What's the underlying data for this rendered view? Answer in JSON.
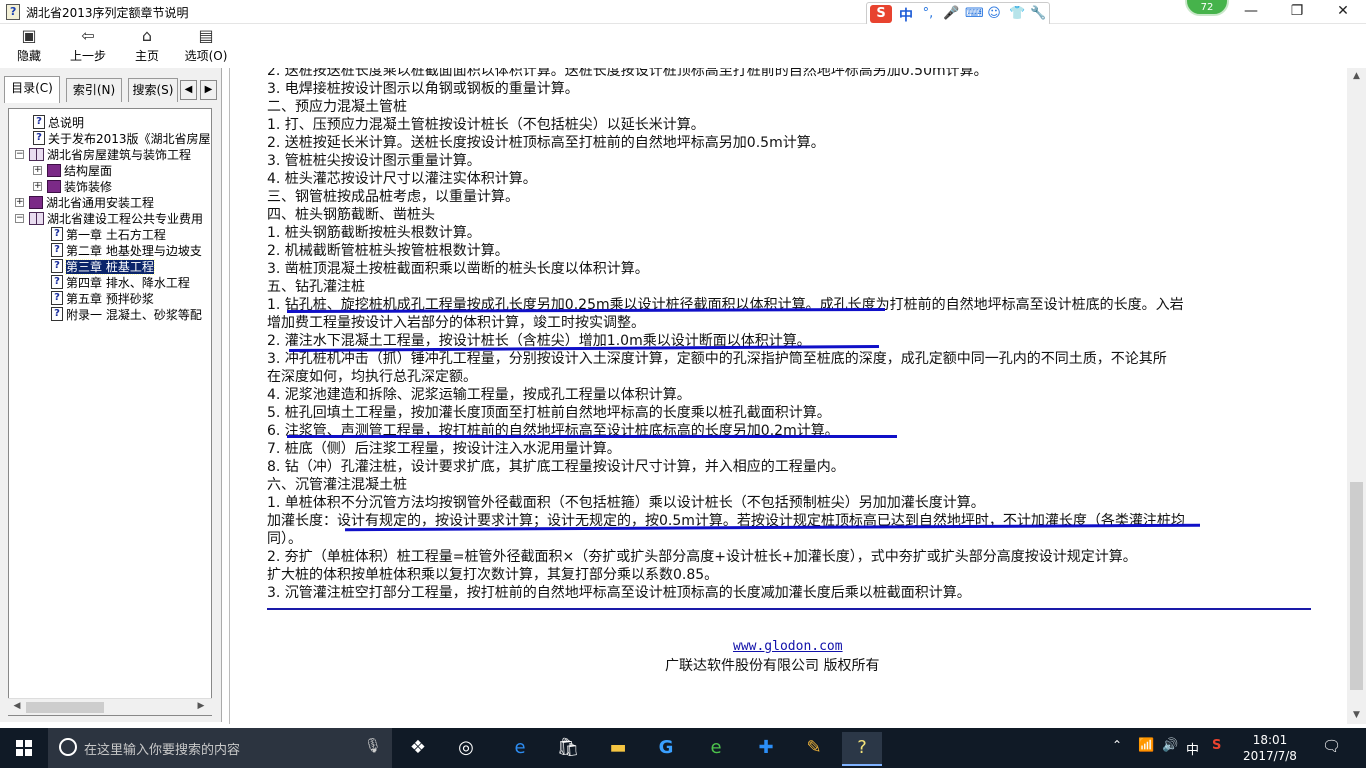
{
  "window": {
    "title": "湖北省2013序列定额章节说明",
    "minimize": "—",
    "restore": "❐",
    "close": "✕"
  },
  "ime": {
    "logo": "S",
    "lang": "中",
    "bubble_count": "72"
  },
  "toolbar": {
    "buttons": [
      {
        "label": "隐藏",
        "icon": "hide-icon"
      },
      {
        "label": "上一步",
        "icon": "back-arrow-icon"
      },
      {
        "label": "主页",
        "icon": "home-icon"
      },
      {
        "label": "选项(O)",
        "icon": "options-icon"
      }
    ]
  },
  "left_tabs": [
    {
      "label": "目录(C)"
    },
    {
      "label": "索引(N)"
    },
    {
      "label": "搜索(S)"
    }
  ],
  "tree": [
    {
      "label": "总说明",
      "type": "topic"
    },
    {
      "label": "关于发布2013版《湖北省房屋",
      "type": "topic"
    },
    {
      "label": "湖北省房屋建筑与装饰工程",
      "type": "book-open"
    },
    {
      "label": "结构屋面",
      "type": "book"
    },
    {
      "label": "装饰装修",
      "type": "book"
    },
    {
      "label": "湖北省通用安装工程",
      "type": "book"
    },
    {
      "label": "湖北省建设工程公共专业费用",
      "type": "book-open"
    },
    {
      "label": "第一章  土石方工程",
      "type": "topic"
    },
    {
      "label": "第二章  地基处理与边坡支",
      "type": "topic"
    },
    {
      "label": "第三章  桩基工程",
      "type": "topic",
      "selected": true
    },
    {
      "label": "第四章  排水、降水工程",
      "type": "topic"
    },
    {
      "label": "第五章  预拌砂浆",
      "type": "topic"
    },
    {
      "label": "附录一  混凝土、砂浆等配",
      "type": "topic"
    }
  ],
  "content": {
    "lines": [
      "2. 送桩按送桩长度乘以桩截面面积以体积计算。送桩长度按设计桩顶标高至打桩前的自然地坪标高另加0.50m计算。",
      "3. 电焊接桩按设计图示以角钢或钢板的重量计算。",
      "二、预应力混凝土管桩",
      "1. 打、压预应力混凝土管桩按设计桩长（不包括桩尖）以延长米计算。",
      "2. 送桩按延长米计算。送桩长度按设计桩顶标高至打桩前的自然地坪标高另加0.5m计算。",
      "3. 管桩桩尖按设计图示重量计算。",
      "4. 桩头灌芯按设计尺寸以灌注实体积计算。",
      "三、钢管桩按成品桩考虑，以重量计算。",
      "四、桩头钢筋截断、凿桩头",
      "1. 桩头钢筋截断按桩头根数计算。",
      "2. 机械截断管桩桩头按管桩根数计算。",
      "3. 凿桩顶混凝土按桩截面积乘以凿断的桩头长度以体积计算。",
      "五、钻孔灌注桩",
      "1. 钻孔桩、旋挖桩机成孔工程量按成孔长度另加0.25m乘以设计桩径截面积以体积计算。成孔长度为打桩前的自然地坪标高至设计桩底的长度。入岩",
      "增加费工程量按设计入岩部分的体积计算，竣工时按实调整。",
      "2. 灌注水下混凝土工程量，按设计桩长（含桩尖）增加1.0m乘以设计断面以体积计算。",
      "3. 冲孔桩机冲击（抓）锤冲孔工程量，分别按设计入土深度计算，定额中的孔深指护筒至桩底的深度，成孔定额中同一孔内的不同土质，不论其所",
      "在深度如何，均执行总孔深定额。",
      "4. 泥浆池建造和拆除、泥浆运输工程量，按成孔工程量以体积计算。",
      "5. 桩孔回填土工程量，按加灌长度顶面至打桩前自然地坪标高的长度乘以桩孔截面积计算。",
      "6. 注浆管、声测管工程量，按打桩前的自然地坪标高至设计桩底标高的长度另加0.2m计算。",
      "7. 桩底（侧）后注浆工程量，按设计注入水泥用量计算。",
      "8. 钻（冲）孔灌注桩，设计要求扩底，其扩底工程量按设计尺寸计算，并入相应的工程量内。",
      "六、沉管灌注混凝土桩",
      "1. 单桩体积不分沉管方法均按钢管外径截面积（不包括桩箍）乘以设计桩长（不包括预制桩尖）另加加灌长度计算。",
      "加灌长度：设计有规定的，按设计要求计算；设计无规定的，按0.5m计算。若按设计规定桩顶标高已达到自然地坪时，不计加灌长度（各类灌注桩均",
      "同）。",
      "2. 夯扩（单桩体积）桩工程量=桩管外径截面积×（夯扩或扩头部分高度+设计桩长+加灌长度），式中夯扩或扩头部分高度按设计规定计算。",
      "扩大桩的体积按单桩体积乘以复打次数计算，其复打部分乘以系数0.85。",
      "3. 沉管灌注桩空打部分工程量，按打桩前的自然地坪标高至设计桩顶标高的长度减加灌长度后乘以桩截面积计算。"
    ],
    "website": "www.glodon.com",
    "copyright": "广联达软件股份有限公司 版权所有"
  },
  "taskbar": {
    "search_placeholder": "在这里输入你要搜索的内容",
    "ime_lang": "中",
    "time": "18:01",
    "date": "2017/7/8"
  }
}
